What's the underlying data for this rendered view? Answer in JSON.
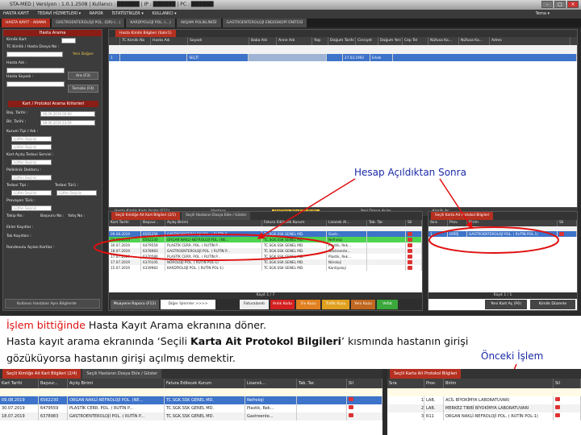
{
  "window": {
    "title": "STA-MED | Versiyon : 1.0.1.2508 | Kullanıcı : ██████ | IP : ██████ | PC : ██████",
    "user_label": "Tema ▾"
  },
  "menu": [
    "HASTA KAYIT",
    "TEDAVİ HİZMETLERİ ▾",
    "RAPOR",
    "İSTATİSTİKLER ▾",
    "KULLANICI ▾"
  ],
  "tabs": [
    "HASTA KAYIT - ARAMA",
    "GASTROENTEROLOJİ POL. (DR)-(...)",
    "KARDİYOLOJİ POL.-(...)",
    "AKŞAM POLİKLİNİĞİ",
    "GASTROENTEROLOJİ ENDOSKOPİ ÜNİTESİ"
  ],
  "left": {
    "title": "Hasta Arama",
    "l_tc": "Kimlik Kart",
    "l_tc2": "TC Kimlik / Hasta Dosya No :",
    "new_btn": "Yeni Doğan",
    "l_ad": "Hasta Adı :",
    "l_soyad": "Hasta Soyadı :",
    "ara_btn": "Ara (F3)",
    "temizle_btn": "Temizle (F4)",
    "criteria_title": "Kart / Protokol Arama Kriterleri",
    "l_bas": "Baş. Tarihi :",
    "v_bas": "08.09.2019 00:00",
    "l_bit": "Bit. Tarihi :",
    "v_bit": "08.09.2019 23:59",
    "l_kurum": "Kurum Tipi / Adı :",
    "ph_sec": "Lütfen Seçiniz",
    "l_kart": "Kart Açılış Tedavi Servisi :",
    "l_polk": "Poliklinik Doktoru :",
    "l_tedavi": "Tedavi Tipi :",
    "l_tedavi2": "Tedavi Türü :",
    "l_prov": "Provayon Türü :",
    "l_takip": "Takip No :",
    "l_bas_no": "Başvuru No :",
    "l_yatis": "Yatış No :",
    "l_ekler": "Ekler Kayıtlar :",
    "l_tak": "Tak Kayıtları :",
    "l_rand": "Randevulu Açılan Kartlar :",
    "bottom_btn": "Kullanıcı Hastaları Aynı Bilgilerde"
  },
  "grid": {
    "title": "Hasta Kimlik Bilgileri  (Satır1)",
    "columns": [
      "TC Kimlik No",
      "Hasta Adı",
      "Soyadı",
      "Baba Adı",
      "Anne Adı",
      "Yaşı",
      "Doğum Tarihi",
      "Cinsiyet",
      "Doğum Yeri",
      "Cep Tel",
      "Nüfusa Ka...",
      "Nüfusa Ka...",
      "Adres"
    ],
    "row": [
      "1",
      "",
      "SEÇİT",
      "",
      "",
      "",
      "27.03.1992",
      "Erkek"
    ],
    "toolbar": [
      "Hasta Kimlik Kartı Yazdır (F11)",
      "Hastaya ...",
      "Hastaya Yeni Kart Açılış",
      "Yeni Dosya Açılış",
      "Kimlik Aç"
    ]
  },
  "sub_left": {
    "tabs": [
      "Seçili Kimliğe Ait Kart Bilgileri   (2/1)",
      "Seçili Hastanın Dosya Ekle / Göster"
    ],
    "columns": [
      "Kart Tarihi",
      "Başvur...",
      "Açılış Birimi",
      "Fatura Edilecek Kurum",
      "Lisanslı Al...",
      "Tab. Tar.",
      "Sil"
    ],
    "rows": [
      [
        "09.08.2019",
        "6565256",
        "GASTROENTEROLOJİ POL. ( RUTİN P...",
        "TC.SGK.SSK GENEL MD.",
        "Gastr...",
        ""
      ],
      [
        "09.08.2019",
        "6562230",
        "ORGAN NAKLİ-NEFROLOJİ POL. (NE...",
        "TC.SGK.SSK GENEL MD.",
        "Nefroloji",
        ""
      ],
      [
        "30.07.2019",
        "6479559",
        "PLASTİK CERR. POL. ( RUTİN P...",
        "TC.SGK.SSK GENEL MD.",
        "Plastik, Rek...",
        ""
      ],
      [
        "18.07.2019",
        "6378983",
        "GASTROENTEROLOJİ POL. ( RUTİN P...",
        "TC.SGK.SSK GENEL MD.",
        "Gastroente...",
        ""
      ],
      [
        "17.07.2019",
        "6370586",
        "PLASTİK CERR. POL. ( RUTİN P...",
        "TC.SGK.SSK GENEL MD.",
        "Plastik, Rek...",
        ""
      ],
      [
        "17.07.2019",
        "6370105",
        "NÖROLOJİ POL. ( RUTİN POL-1)",
        "TC.SGK.SSK GENEL MD.",
        "Nöroloji",
        ""
      ],
      [
        "15.07.2019",
        "6339983",
        "KARDİYOLOJİ POL. ( RUTİN POL-1)",
        "TC.SGK.SSK GENEL MD.",
        "Kardiyoloji",
        ""
      ]
    ],
    "pager": "Kayıt 1 / 7",
    "buttons": [
      "Muayene Raporu (F12)",
      "Diğer İşlemler  >>>>",
      "Faturalandı",
      "Anlık Kodu",
      "3'e Kuzu",
      "Trafik Kuzu",
      "Yeni Kuzu",
      "Vefat"
    ]
  },
  "sub_right": {
    "tab": "Seçili Karta Ait Protokol Bilgileri",
    "columns": [
      "Sıra",
      "Prov.",
      "Birim",
      "Sil"
    ],
    "row": [
      "1",
      "GİRİŞ",
      "GASTROENTEROLOJİ POL. ( RUTİN POL-1)"
    ],
    "pager": "Kayıt 1 / 1",
    "buttons": [
      "Yeni Kart Aç (F6)",
      "Kimlik Düzenle"
    ]
  },
  "annotations": {
    "after": "Hesap Açıldıktan Sonra",
    "before": "Önceki İşlem"
  },
  "caption": {
    "p1_red": "İşlem bittiğinde",
    "p1_rest": " Hasta Kayıt Arama ekranına döner.",
    "p2_pre": "Hasta kayıt arama ekranında ‘Seçili ",
    "p2_bold": "Karta Ait Protokol Bilgileri",
    "p2_post": "’ kısmında hastanın girişi",
    "p3": "gözüküyorsa hastanın girişi açılmış demektir."
  },
  "bottom": {
    "tabs_left": [
      "Seçili Kimliğe Ait Kart Bilgileri   (2/4)",
      "Seçili Hastanın Dosya Ekle / Göster"
    ],
    "tab_right": "Seçili Karta Ait Protokol Bilgileri",
    "columns_left": [
      "Kart Tarihi",
      "Başvur...",
      "Açılış Birimi",
      "Fatura Edilecek Kurum",
      "Lisanslı...",
      "Tab. Tar.",
      "Sil"
    ],
    "rows_left": [
      [
        "09.08.2019",
        "6562230",
        "ORGAN NAKLİ-NEFROLOJİ POL. (NE...",
        "TC.SGK.SSK GENEL MD.",
        "Nefroloji"
      ],
      [
        "30.07.2019",
        "6479559",
        "PLASTİK CERR. POL. ( RUTİN P...",
        "TC.SGK.SSK GENEL MD.",
        "Plastik, Rek..."
      ],
      [
        "18.07.2019",
        "6378983",
        "GASTROENTEROLOJİ POL. ( RUTİN P...",
        "TC.SGK.SSK GENEL MD.",
        "Gastroente..."
      ]
    ],
    "columns_right": [
      "Sıra",
      "Prov.",
      "Birim",
      "Sil"
    ],
    "rows_right": [
      [
        "1",
        "LAB.",
        "ACİL BİYOKİMYA LABORATUVARI"
      ],
      [
        "2",
        "LAB.",
        "MERKEZ TIBBİ BİYOKİMYA LABORATUVARI"
      ],
      [
        "3",
        "R11",
        "ORGAN NAKLİ-NEFROLOJİ POL. ( RUTİN POL-1)"
      ]
    ]
  },
  "colors": {
    "accent": "#8a1e16",
    "selected": "#3d73c9",
    "highlight": "#4fd44f",
    "arrow": "#e01010",
    "annotation": "#1a2aa8"
  }
}
